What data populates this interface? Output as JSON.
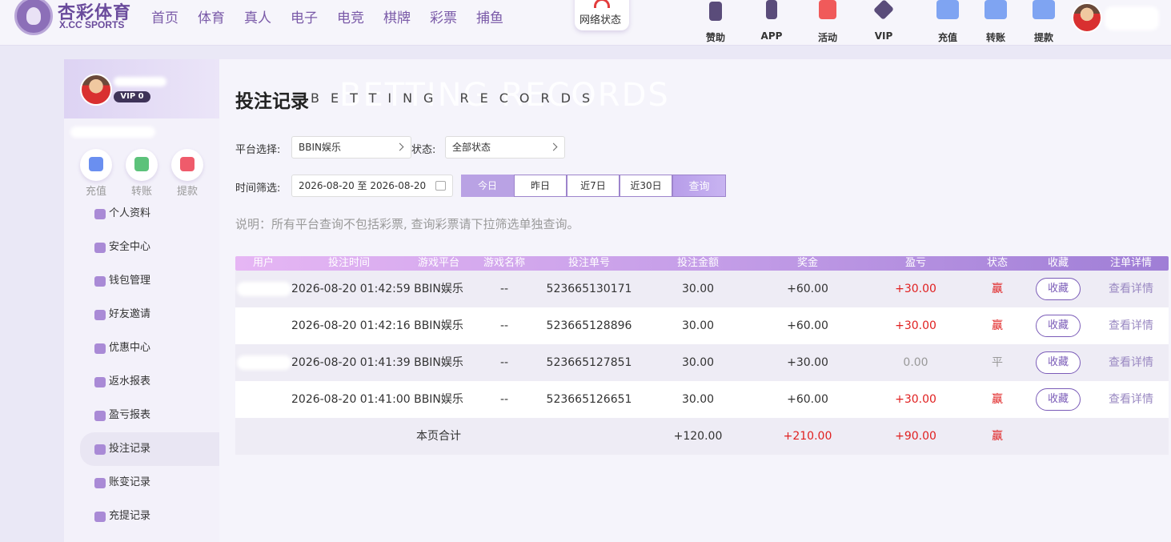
{
  "brand": {
    "name": "杏彩体育",
    "sub": "X.CC SPORTS"
  },
  "nav": [
    "首页",
    "体育",
    "真人",
    "电子",
    "电竞",
    "棋牌",
    "彩票",
    "捕鱼"
  ],
  "network_status": "网络状态",
  "tools": [
    {
      "label": "赞助",
      "icon": "bookmark-star-icon"
    },
    {
      "label": "APP",
      "icon": "phone-icon"
    },
    {
      "label": "活动",
      "icon": "gift-icon"
    },
    {
      "label": "VIP",
      "icon": "diamond-icon"
    },
    {
      "label": "充值",
      "icon": "wallet-deposit-icon"
    },
    {
      "label": "转账",
      "icon": "wallet-transfer-icon"
    },
    {
      "label": "提款",
      "icon": "wallet-withdraw-icon"
    }
  ],
  "sidebar": {
    "vip": "VIP 0",
    "quick_actions": [
      {
        "label": "充值",
        "color": "#6a8ff0"
      },
      {
        "label": "转账",
        "color": "#5cc27a"
      },
      {
        "label": "提款",
        "color": "#ef5b6b"
      }
    ],
    "menu": [
      "个人资料",
      "安全中心",
      "钱包管理",
      "好友邀请",
      "优惠中心",
      "返水报表",
      "盈亏报表",
      "投注记录",
      "账变记录",
      "充提记录"
    ],
    "active_index": 7
  },
  "page": {
    "title": "投注记录",
    "subtitle": "BETTING RECORDS",
    "platform_label": "平台选择:",
    "platform_value": "BBIN娱乐",
    "status_label": "状态:",
    "status_value": "全部状态",
    "time_label": "时间筛选:",
    "date_range": "2026-08-20 至 2026-08-20",
    "quick_ranges": [
      "今日",
      "昨日",
      "近7日",
      "近30日"
    ],
    "active_range": 0,
    "query": "查询",
    "note": "说明：所有平台查询不包括彩票, 查询彩票请下拉筛选单独查询。"
  },
  "table": {
    "columns": [
      "用户",
      "投注时间",
      "游戏平台",
      "游戏名称",
      "投注单号",
      "投注金额",
      "奖金",
      "盈亏",
      "状态",
      "收藏",
      "注单详情"
    ],
    "rows": [
      {
        "time": "2026-08-20 01:42:59",
        "platform": "BBIN娱乐",
        "game": "--",
        "order": "523665130171",
        "amount": "30.00",
        "bonus": "+60.00",
        "pl": "+30.00",
        "status": "赢",
        "fav": "收藏",
        "detail": "查看详情"
      },
      {
        "time": "2026-08-20 01:42:16",
        "platform": "BBIN娱乐",
        "game": "--",
        "order": "523665128896",
        "amount": "30.00",
        "bonus": "+60.00",
        "pl": "+30.00",
        "status": "赢",
        "fav": "收藏",
        "detail": "查看详情"
      },
      {
        "time": "2026-08-20 01:41:39",
        "platform": "BBIN娱乐",
        "game": "--",
        "order": "523665127851",
        "amount": "30.00",
        "bonus": "+30.00",
        "pl": "0.00",
        "status": "平",
        "fav": "收藏",
        "detail": "查看详情"
      },
      {
        "time": "2026-08-20 01:41:00",
        "platform": "BBIN娱乐",
        "game": "--",
        "order": "523665126651",
        "amount": "30.00",
        "bonus": "+60.00",
        "pl": "+30.00",
        "status": "赢",
        "fav": "收藏",
        "detail": "查看详情"
      }
    ],
    "total": {
      "label": "本页合计",
      "amount": "+120.00",
      "bonus": "+210.00",
      "pl": "+90.00",
      "status": "赢"
    }
  },
  "colors": {
    "accent": "#7b5cb8",
    "win": "#e02020",
    "draw": "#999999"
  }
}
